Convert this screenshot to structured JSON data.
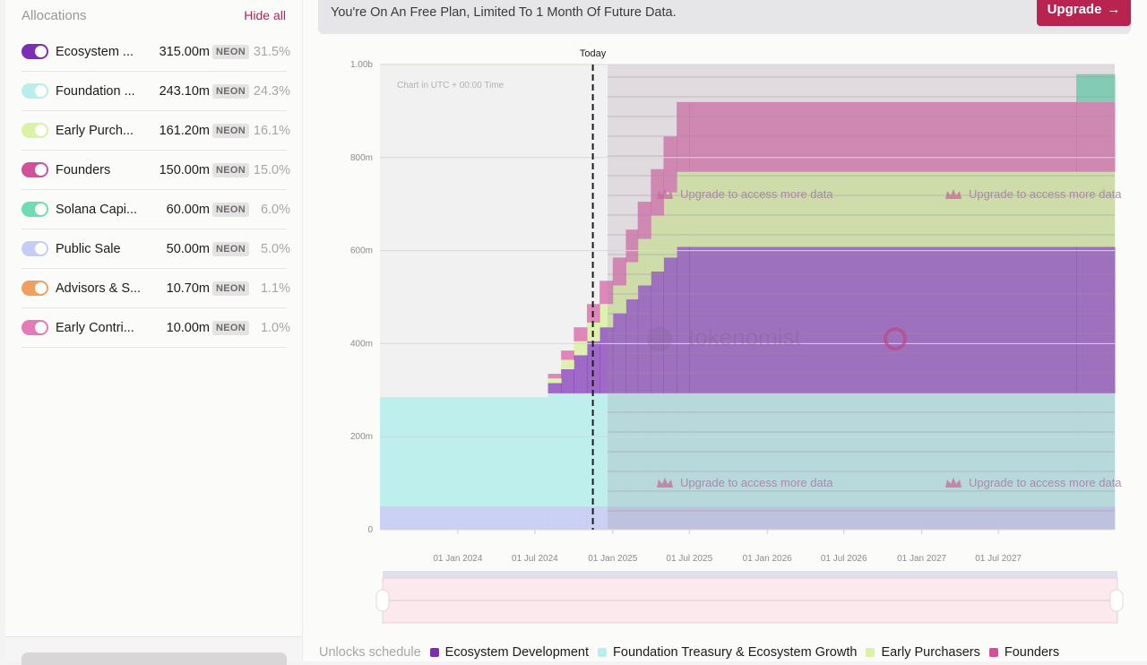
{
  "sidebar": {
    "title": "Allocations",
    "hide_all_label": "Hide all",
    "items": [
      {
        "name": "Ecosystem ...",
        "amount": "315.00m",
        "token": "NEON",
        "pct": "31.5%",
        "color": "#7a2fb5",
        "enabled": true
      },
      {
        "name": "Foundation ...",
        "amount": "243.10m",
        "token": "NEON",
        "pct": "24.3%",
        "color": "#b9eeec",
        "enabled": true
      },
      {
        "name": "Early Purch...",
        "amount": "161.20m",
        "token": "NEON",
        "pct": "16.1%",
        "color": "#d9f2a6",
        "enabled": true
      },
      {
        "name": "Founders",
        "amount": "150.00m",
        "token": "NEON",
        "pct": "15.0%",
        "color": "#d24f9a",
        "enabled": true
      },
      {
        "name": "Solana Capi...",
        "amount": "60.00m",
        "token": "NEON",
        "pct": "6.0%",
        "color": "#6fdcb6",
        "enabled": true
      },
      {
        "name": "Public Sale",
        "amount": "50.00m",
        "token": "NEON",
        "pct": "5.0%",
        "color": "#c5cdf2",
        "enabled": true
      },
      {
        "name": "Advisors & S...",
        "amount": "10.70m",
        "token": "NEON",
        "pct": "1.1%",
        "color": "#ef9f5f",
        "enabled": true
      },
      {
        "name": "Early Contri...",
        "amount": "10.00m",
        "token": "NEON",
        "pct": "1.0%",
        "color": "#e57ab9",
        "enabled": true
      }
    ]
  },
  "banner": {
    "text": "You're On An Free Plan, Limited To 1 Month Of Future Data.",
    "upgrade_label": "Upgrade",
    "upgrade_icon": "arrow-right-icon"
  },
  "chart": {
    "today_label": "Today",
    "timezone_note": "Chart in UTC + 00:00 Time",
    "watermark": "tokenomist",
    "locked_message": "Upgrade to access more data",
    "locked_icon": "crown-icon"
  },
  "legend": {
    "title": "Unlocks schedule",
    "items": [
      {
        "label": "Ecosystem Development",
        "color": "#7a2fb5"
      },
      {
        "label": "Foundation Treasury & Ecosystem Growth",
        "color": "#b9eeec"
      },
      {
        "label": "Early Purchasers",
        "color": "#d9f2a6"
      },
      {
        "label": "Founders",
        "color": "#d24f9a"
      }
    ]
  },
  "chart_data": {
    "type": "area",
    "title": "Unlocks schedule",
    "xlabel": "",
    "ylabel": "",
    "ylim": [
      0,
      1000
    ],
    "y_unit": "m NEON",
    "yticks": [
      {
        "value": 0,
        "label": "0"
      },
      {
        "value": 200,
        "label": "200m"
      },
      {
        "value": 400,
        "label": "400m"
      },
      {
        "value": 600,
        "label": "600m"
      },
      {
        "value": 800,
        "label": "800m"
      },
      {
        "value": 1000,
        "label": "1.00b"
      }
    ],
    "xlim": [
      "2023-07",
      "2028-04"
    ],
    "xticks": [
      "01 Jan 2024",
      "01 Jul 2024",
      "01 Jan 2025",
      "01 Jul 2025",
      "01 Jan 2026",
      "01 Jul 2026",
      "01 Jan 2027",
      "01 Jul 2027"
    ],
    "today": "2024-11-15",
    "locked_from": "2024-12-20",
    "grid": true,
    "legend_position": "bottom",
    "x": [
      "2023-07",
      "2024-08",
      "2024-09",
      "2024-10",
      "2024-11",
      "2024-12",
      "2025-01",
      "2025-02",
      "2025-03",
      "2025-04",
      "2025-05",
      "2025-06",
      "2025-07",
      "2028-01",
      "2028-04"
    ],
    "series": [
      {
        "name": "Public Sale",
        "color": "#c5cdf2",
        "values": [
          50,
          50,
          50,
          50,
          50,
          50,
          50,
          50,
          50,
          50,
          50,
          50,
          50,
          50,
          50
        ]
      },
      {
        "name": "Foundation Treasury & Ecosystem Growth",
        "color": "#b9eeec",
        "values": [
          235,
          243.1,
          243.1,
          243.1,
          243.1,
          243.1,
          243.1,
          243.1,
          243.1,
          243.1,
          243.1,
          243.1,
          243.1,
          243.1,
          243.1
        ]
      },
      {
        "name": "Ecosystem Development",
        "color": "#7a2fb5",
        "values": [
          0,
          22,
          52,
          82,
          112,
          142,
          172,
          202,
          232,
          262,
          292,
          315,
          315,
          315,
          315
        ]
      },
      {
        "name": "Early Purchasers",
        "color": "#d9f2a6",
        "values": [
          0,
          10,
          20,
          30,
          40,
          50,
          60,
          80,
          100,
          120,
          140,
          161.2,
          161.2,
          161.2,
          161.2
        ]
      },
      {
        "name": "Founders",
        "color": "#d24f9a",
        "values": [
          0,
          10,
          20,
          30,
          40,
          50,
          60,
          70,
          80,
          100,
          120,
          150,
          150,
          150,
          150
        ]
      },
      {
        "name": "Solana Capital",
        "color": "#6fdcb6",
        "values": [
          0,
          0,
          0,
          0,
          0,
          0,
          0,
          0,
          0,
          0,
          0,
          0,
          0,
          60,
          60
        ]
      }
    ]
  }
}
